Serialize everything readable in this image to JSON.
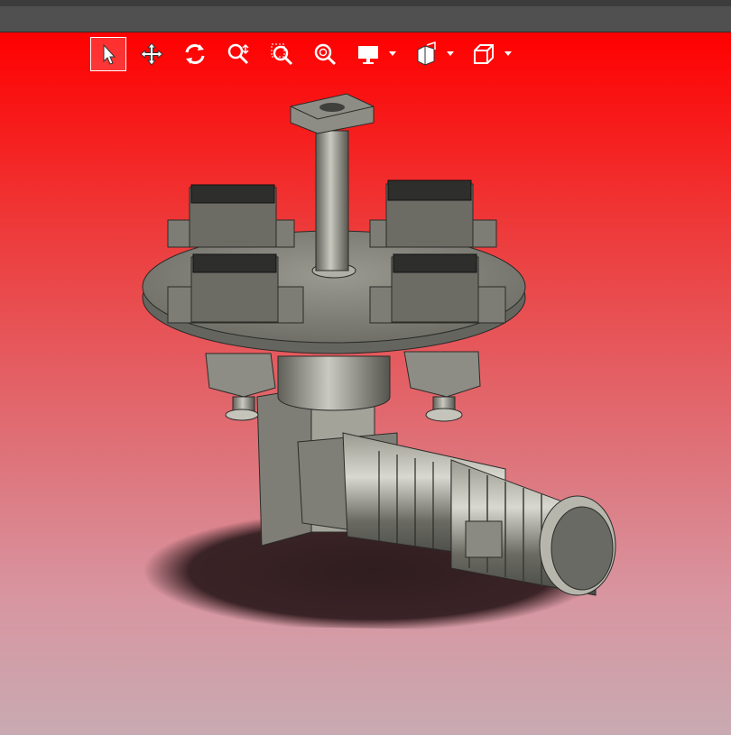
{
  "window": {
    "title_bar_color": "#505050"
  },
  "viewport": {
    "background_top": "#ff0000",
    "background_bottom": "#c9aab2"
  },
  "toolbar": {
    "buttons": [
      {
        "id": "select",
        "icon": "cursor-arrow-icon",
        "active": true
      },
      {
        "id": "pan",
        "icon": "move-arrows-icon",
        "active": false
      },
      {
        "id": "rotate",
        "icon": "rotate-icon",
        "active": false
      },
      {
        "id": "zoom-in-out",
        "icon": "zoom-in-out-icon",
        "active": false
      },
      {
        "id": "zoom-window",
        "icon": "zoom-window-icon",
        "active": false
      },
      {
        "id": "zoom-fit",
        "icon": "zoom-fit-icon",
        "active": false
      },
      {
        "id": "display-style",
        "icon": "monitor-icon",
        "active": false,
        "dropdown": true
      },
      {
        "id": "section-view",
        "icon": "section-view-icon",
        "active": false,
        "dropdown": true
      },
      {
        "id": "view-orientation",
        "icon": "cube-icon",
        "active": false,
        "dropdown": true
      }
    ]
  },
  "model": {
    "description_icon": "cad-assembly-rotary-table-with-motor",
    "body_color": "#8a8a80",
    "shadow_color": "#3a2326"
  }
}
